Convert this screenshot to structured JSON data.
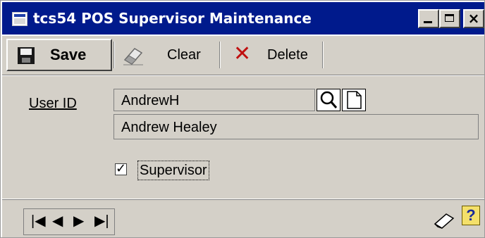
{
  "window": {
    "title": "tcs54 POS Supervisor Maintenance",
    "minimize_glyph": "",
    "maximize_glyph": "",
    "close_glyph": "×"
  },
  "toolbar": {
    "save_label": "Save",
    "clear_label": "Clear",
    "delete_label": "Delete",
    "delete_icon": "✕"
  },
  "form": {
    "user_id_label": "User ID",
    "user_id_value": "AndrewH",
    "user_name_value": "Andrew Healey",
    "supervisor_label": "Supervisor",
    "supervisor_checked": true,
    "check_glyph": "✓"
  },
  "nav": {
    "first": "|◀",
    "prev": "◀",
    "next": "▶",
    "last": "▶|"
  },
  "help": {
    "glyph": "?"
  },
  "icons": {
    "window": "window-icon",
    "save": "floppy-disk-icon",
    "clear": "eraser-icon",
    "delete": "red-x-icon",
    "lookup": "magnifier-icon",
    "new": "blank-page-icon",
    "note": "note-icon",
    "help": "help-question-icon"
  },
  "colors": {
    "titlebar": "#001a8c",
    "panel": "#d4d0c8",
    "delete_red": "#c01010"
  }
}
